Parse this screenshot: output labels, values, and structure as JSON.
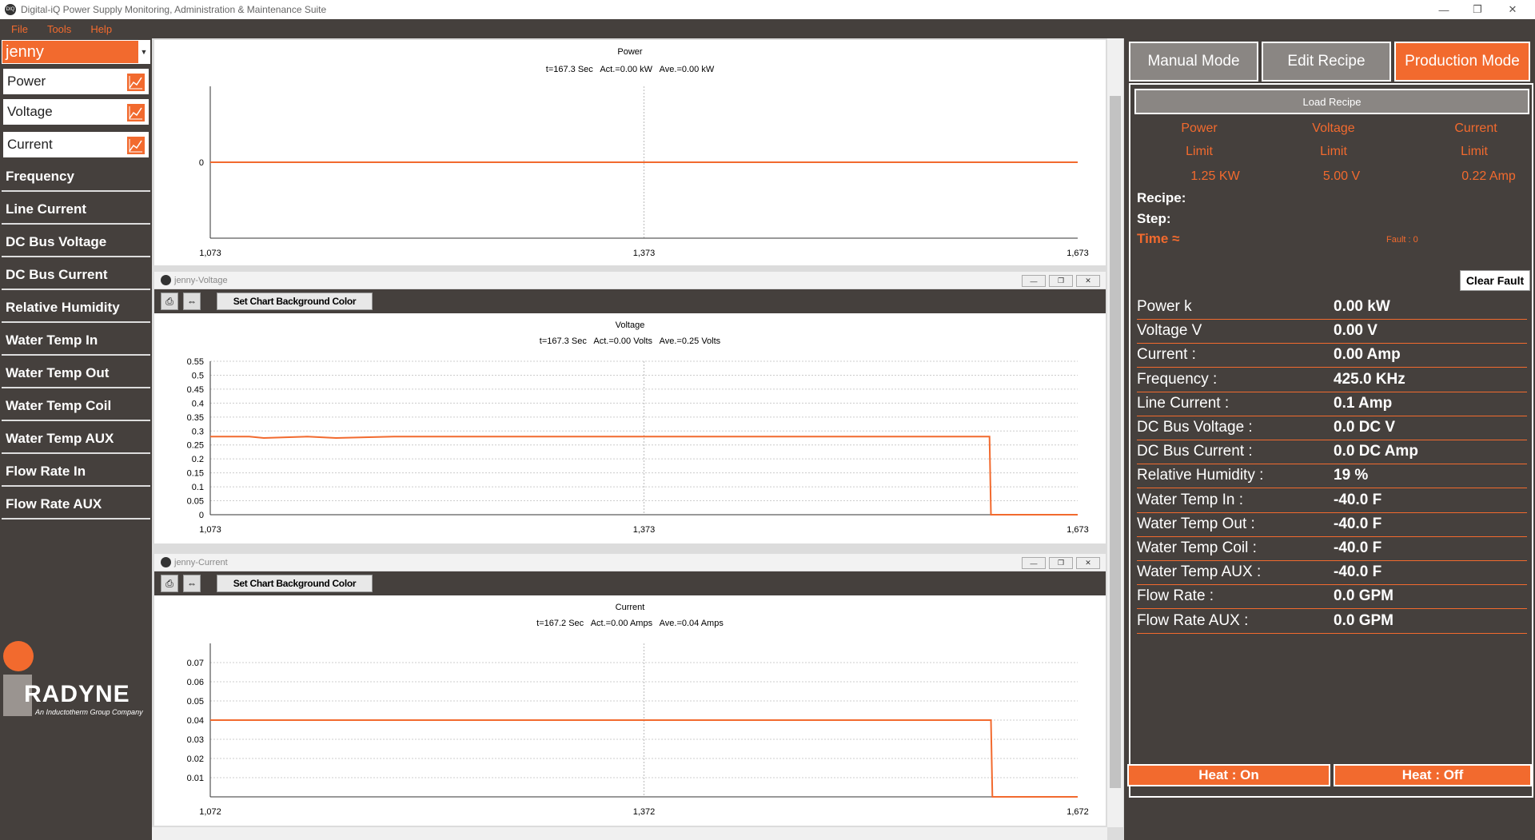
{
  "app": {
    "title": "Digital-iQ Power Supply Monitoring, Administration & Maintenance Suite"
  },
  "menu": [
    "File",
    "Tools",
    "Help"
  ],
  "window_controls": {
    "minimize": "—",
    "restore": "❐",
    "close": "✕"
  },
  "user": {
    "selected": "jenny"
  },
  "nav": [
    {
      "label": "Power",
      "style": "white",
      "chart": true
    },
    {
      "label": "Voltage",
      "style": "white",
      "chart": true
    },
    {
      "label": "Current",
      "style": "white",
      "chart": true
    },
    {
      "label": "Frequency",
      "style": "dark"
    },
    {
      "label": "Line Current",
      "style": "dark"
    },
    {
      "label": "DC Bus Voltage",
      "style": "dark"
    },
    {
      "label": "DC Bus Current",
      "style": "dark"
    },
    {
      "label": "Relative Humidity",
      "style": "dark"
    },
    {
      "label": "Water Temp In",
      "style": "dark"
    },
    {
      "label": "Water Temp Out",
      "style": "dark"
    },
    {
      "label": "Water Temp Coil",
      "style": "dark"
    },
    {
      "label": "Water Temp AUX",
      "style": "dark"
    },
    {
      "label": "Flow Rate In",
      "style": "dark"
    },
    {
      "label": "Flow Rate AUX",
      "style": "dark"
    }
  ],
  "logo": {
    "word": "RADYNE",
    "sub": "An Inductotherm Group Company"
  },
  "charts": {
    "power": {
      "window_title": "",
      "title": "Power",
      "stats": "t=167.3 Sec   Act.=0.00 kW   Ave.=0.00 kW"
    },
    "voltage": {
      "window_title": "jenny-Voltage",
      "button": "Set Chart Background Color",
      "title": "Voltage",
      "stats": "t=167.3 Sec   Act.=0.00 Volts   Ave.=0.25 Volts"
    },
    "current": {
      "window_title": "jenny-Current",
      "button": "Set Chart Background Color",
      "title": "Current",
      "stats": "t=167.2 Sec   Act.=0.00 Amps   Ave.=0.04 Amps"
    }
  },
  "chart_data": [
    {
      "type": "line",
      "title": "Power",
      "x_ticks": [
        "1,073",
        "1,373",
        "1,673"
      ],
      "y_ticks": [
        "0"
      ],
      "xlim": [
        1073,
        1673
      ],
      "ylim": [
        -1,
        1
      ],
      "series": [
        {
          "x": [
            1073,
            1673
          ],
          "y": [
            0,
            0
          ]
        }
      ],
      "color": "#f26a2e"
    },
    {
      "type": "line",
      "title": "Voltage",
      "x_ticks": [
        "1,073",
        "1,373",
        "1,673"
      ],
      "y_ticks": [
        "0",
        "0.05",
        "0.1",
        "0.15",
        "0.2",
        "0.25",
        "0.3",
        "0.35",
        "0.4",
        "0.45",
        "0.5",
        "0.55"
      ],
      "xlim": [
        1073,
        1673
      ],
      "ylim": [
        0,
        0.55
      ],
      "series": [
        {
          "x": [
            1073,
            1100,
            1110,
            1140,
            1160,
            1200,
            1260,
            1300,
            1500,
            1600,
            1610,
            1612,
            1613,
            1673
          ],
          "y": [
            0.28,
            0.28,
            0.275,
            0.28,
            0.275,
            0.28,
            0.28,
            0.28,
            0.28,
            0.28,
            0.28,
            0.28,
            0,
            0
          ]
        }
      ],
      "color": "#f26a2e"
    },
    {
      "type": "line",
      "title": "Current",
      "x_ticks": [
        "1,072",
        "1,372",
        "1,672"
      ],
      "y_ticks": [
        "0.01",
        "0.02",
        "0.03",
        "0.04",
        "0.05",
        "0.06",
        "0.07"
      ],
      "xlim": [
        1072,
        1672
      ],
      "ylim": [
        0,
        0.08
      ],
      "series": [
        {
          "x": [
            1072,
            1612,
            1613,
            1672
          ],
          "y": [
            0.04,
            0.04,
            0,
            0
          ]
        }
      ],
      "color": "#f26a2e"
    }
  ],
  "right": {
    "tabs": [
      "Manual Mode",
      "Edit Recipe",
      "Production Mode"
    ],
    "load_recipe": "Load Recipe",
    "limits": [
      {
        "name": "Power",
        "word": "Limit",
        "value": "1.25 KW"
      },
      {
        "name": "Voltage",
        "word": "Limit",
        "value": "5.00 V"
      },
      {
        "name": "Current",
        "word": "Limit",
        "value": "0.22 Amp"
      }
    ],
    "recipe_label": "Recipe:",
    "step_label": "Step:",
    "time_label": "Time ≈",
    "fault_label": "Fault : 0",
    "clear_fault": "Clear Fault",
    "metrics": [
      {
        "k": "Power k",
        "v": "0.00 kW"
      },
      {
        "k": "Voltage V",
        "v": "0.00 V"
      },
      {
        "k": "Current :",
        "v": "0.00 Amp"
      },
      {
        "k": "Frequency :",
        "v": "425.0 KHz"
      },
      {
        "k": "Line Current :",
        "v": "0.1 Amp"
      },
      {
        "k": "DC Bus Voltage :",
        "v": "0.0 DC V"
      },
      {
        "k": "DC Bus Current :",
        "v": "0.0 DC Amp"
      },
      {
        "k": "Relative Humidity :",
        "v": "19 %"
      },
      {
        "k": "Water Temp In :",
        "v": "-40.0 F"
      },
      {
        "k": "Water Temp Out :",
        "v": "-40.0 F"
      },
      {
        "k": "Water Temp Coil :",
        "v": "-40.0 F"
      },
      {
        "k": "Water Temp AUX :",
        "v": "-40.0 F"
      },
      {
        "k": "Flow Rate :",
        "v": "0.0 GPM"
      },
      {
        "k": "Flow Rate AUX :",
        "v": "0.0 GPM"
      }
    ],
    "heat_on": "Heat : On",
    "heat_off": "Heat : Off"
  }
}
